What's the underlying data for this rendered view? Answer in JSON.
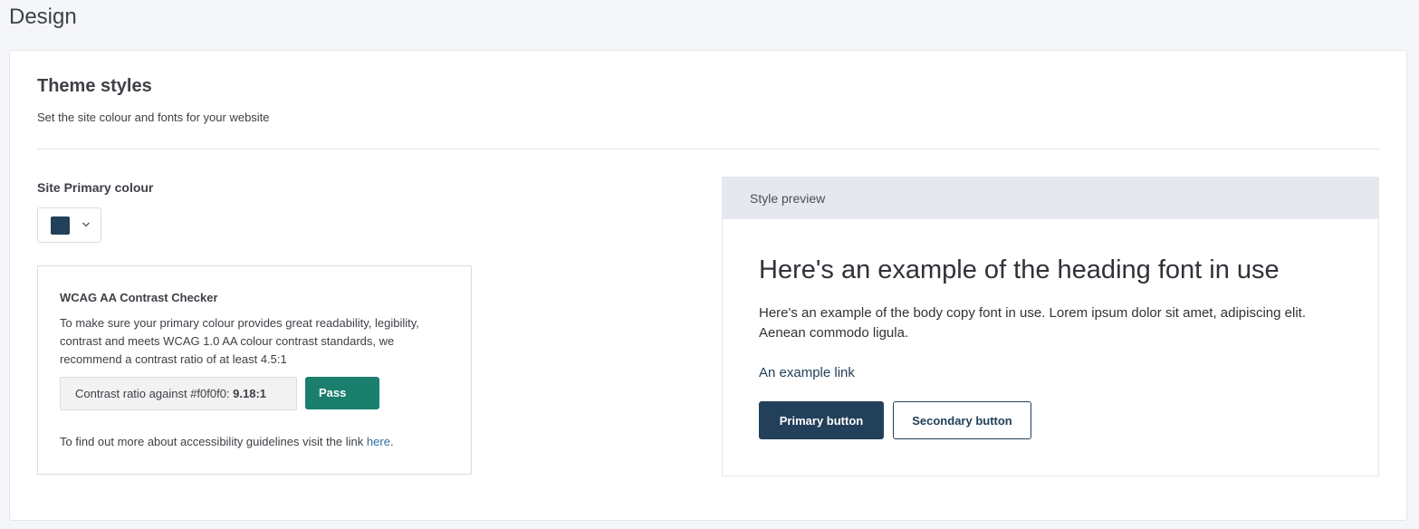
{
  "page": {
    "title": "Design"
  },
  "theme": {
    "title": "Theme styles",
    "subtitle": "Set the site colour and fonts for your website"
  },
  "primary_colour": {
    "label": "Site Primary colour",
    "value": "#22405a",
    "dropdown_icon": "chevron-down-icon"
  },
  "contrast_checker": {
    "title": "WCAG AA Contrast Checker",
    "description": "To make sure your primary colour provides great readability, legibility, contrast and meets WCAG 1.0 AA colour contrast standards, we recommend a contrast ratio of at least 4.5:1",
    "ratio_label": "Contrast ratio against #f0f0f0: ",
    "ratio_value": "9.18:1",
    "status": "Pass",
    "status_color": "#1a7f6c",
    "footer_text": "To find out more about accessibility guidelines visit the link ",
    "footer_link": "here",
    "footer_end": ".",
    "link_color": "#2b6ea3"
  },
  "preview": {
    "header": "Style preview",
    "heading": "Here's an example of the heading font in use",
    "body": "Here's an example of the body copy font in use. Lorem ipsum dolor sit amet, adipiscing elit. Aenean commodo ligula.",
    "link": "An example link",
    "primary_button": "Primary button",
    "secondary_button": "Secondary button",
    "accent_color": "#22405a"
  }
}
